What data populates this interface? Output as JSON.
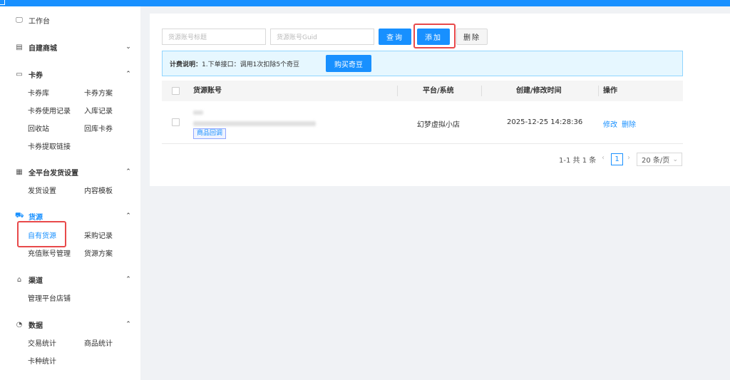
{
  "sidebar": {
    "workbench": "工作台",
    "mall": "自建商城",
    "coupon": {
      "title": "卡券",
      "items": [
        "卡券库",
        "卡券方案",
        "卡券使用记录",
        "入库记录",
        "回收站",
        "回库卡券",
        "卡券提取链接"
      ]
    },
    "delivery": {
      "title": "全平台发货设置",
      "items": [
        "发货设置",
        "内容模板"
      ]
    },
    "source": {
      "title": "货源",
      "items": [
        "自有货源",
        "采购记录",
        "充值账号管理",
        "货源方案"
      ]
    },
    "channel": {
      "title": "渠道",
      "items": [
        "管理平台店铺"
      ]
    },
    "data": {
      "title": "数据",
      "items": [
        "交易统计",
        "商品统计",
        "卡种统计"
      ]
    }
  },
  "toolbar": {
    "title_placeholder": "货源账号标题",
    "guid_placeholder": "货源账号Guid",
    "query_label": "查询",
    "add_label": "添加",
    "delete_label": "删除"
  },
  "notice": {
    "label": "计费说明：",
    "text": "1.下单接口：调用1次扣除5个奇豆",
    "buy_label": "购买奇豆"
  },
  "table": {
    "headers": [
      "货源账号",
      "平台/系统",
      "创建/修改时间",
      "操作"
    ],
    "rows": [
      {
        "tag": "商品回调",
        "platform": "幻梦虚拟小店",
        "time": "2025-12-25 14:28:36",
        "edit": "修改",
        "delete": "删除"
      }
    ]
  },
  "pagination": {
    "summary": "1-1 共 1 条",
    "current": "1",
    "page_size": "20 条/页"
  },
  "colors": {
    "primary": "#1890ff",
    "highlight": "#e8494a",
    "notice_bg": "#e6f7ff"
  }
}
